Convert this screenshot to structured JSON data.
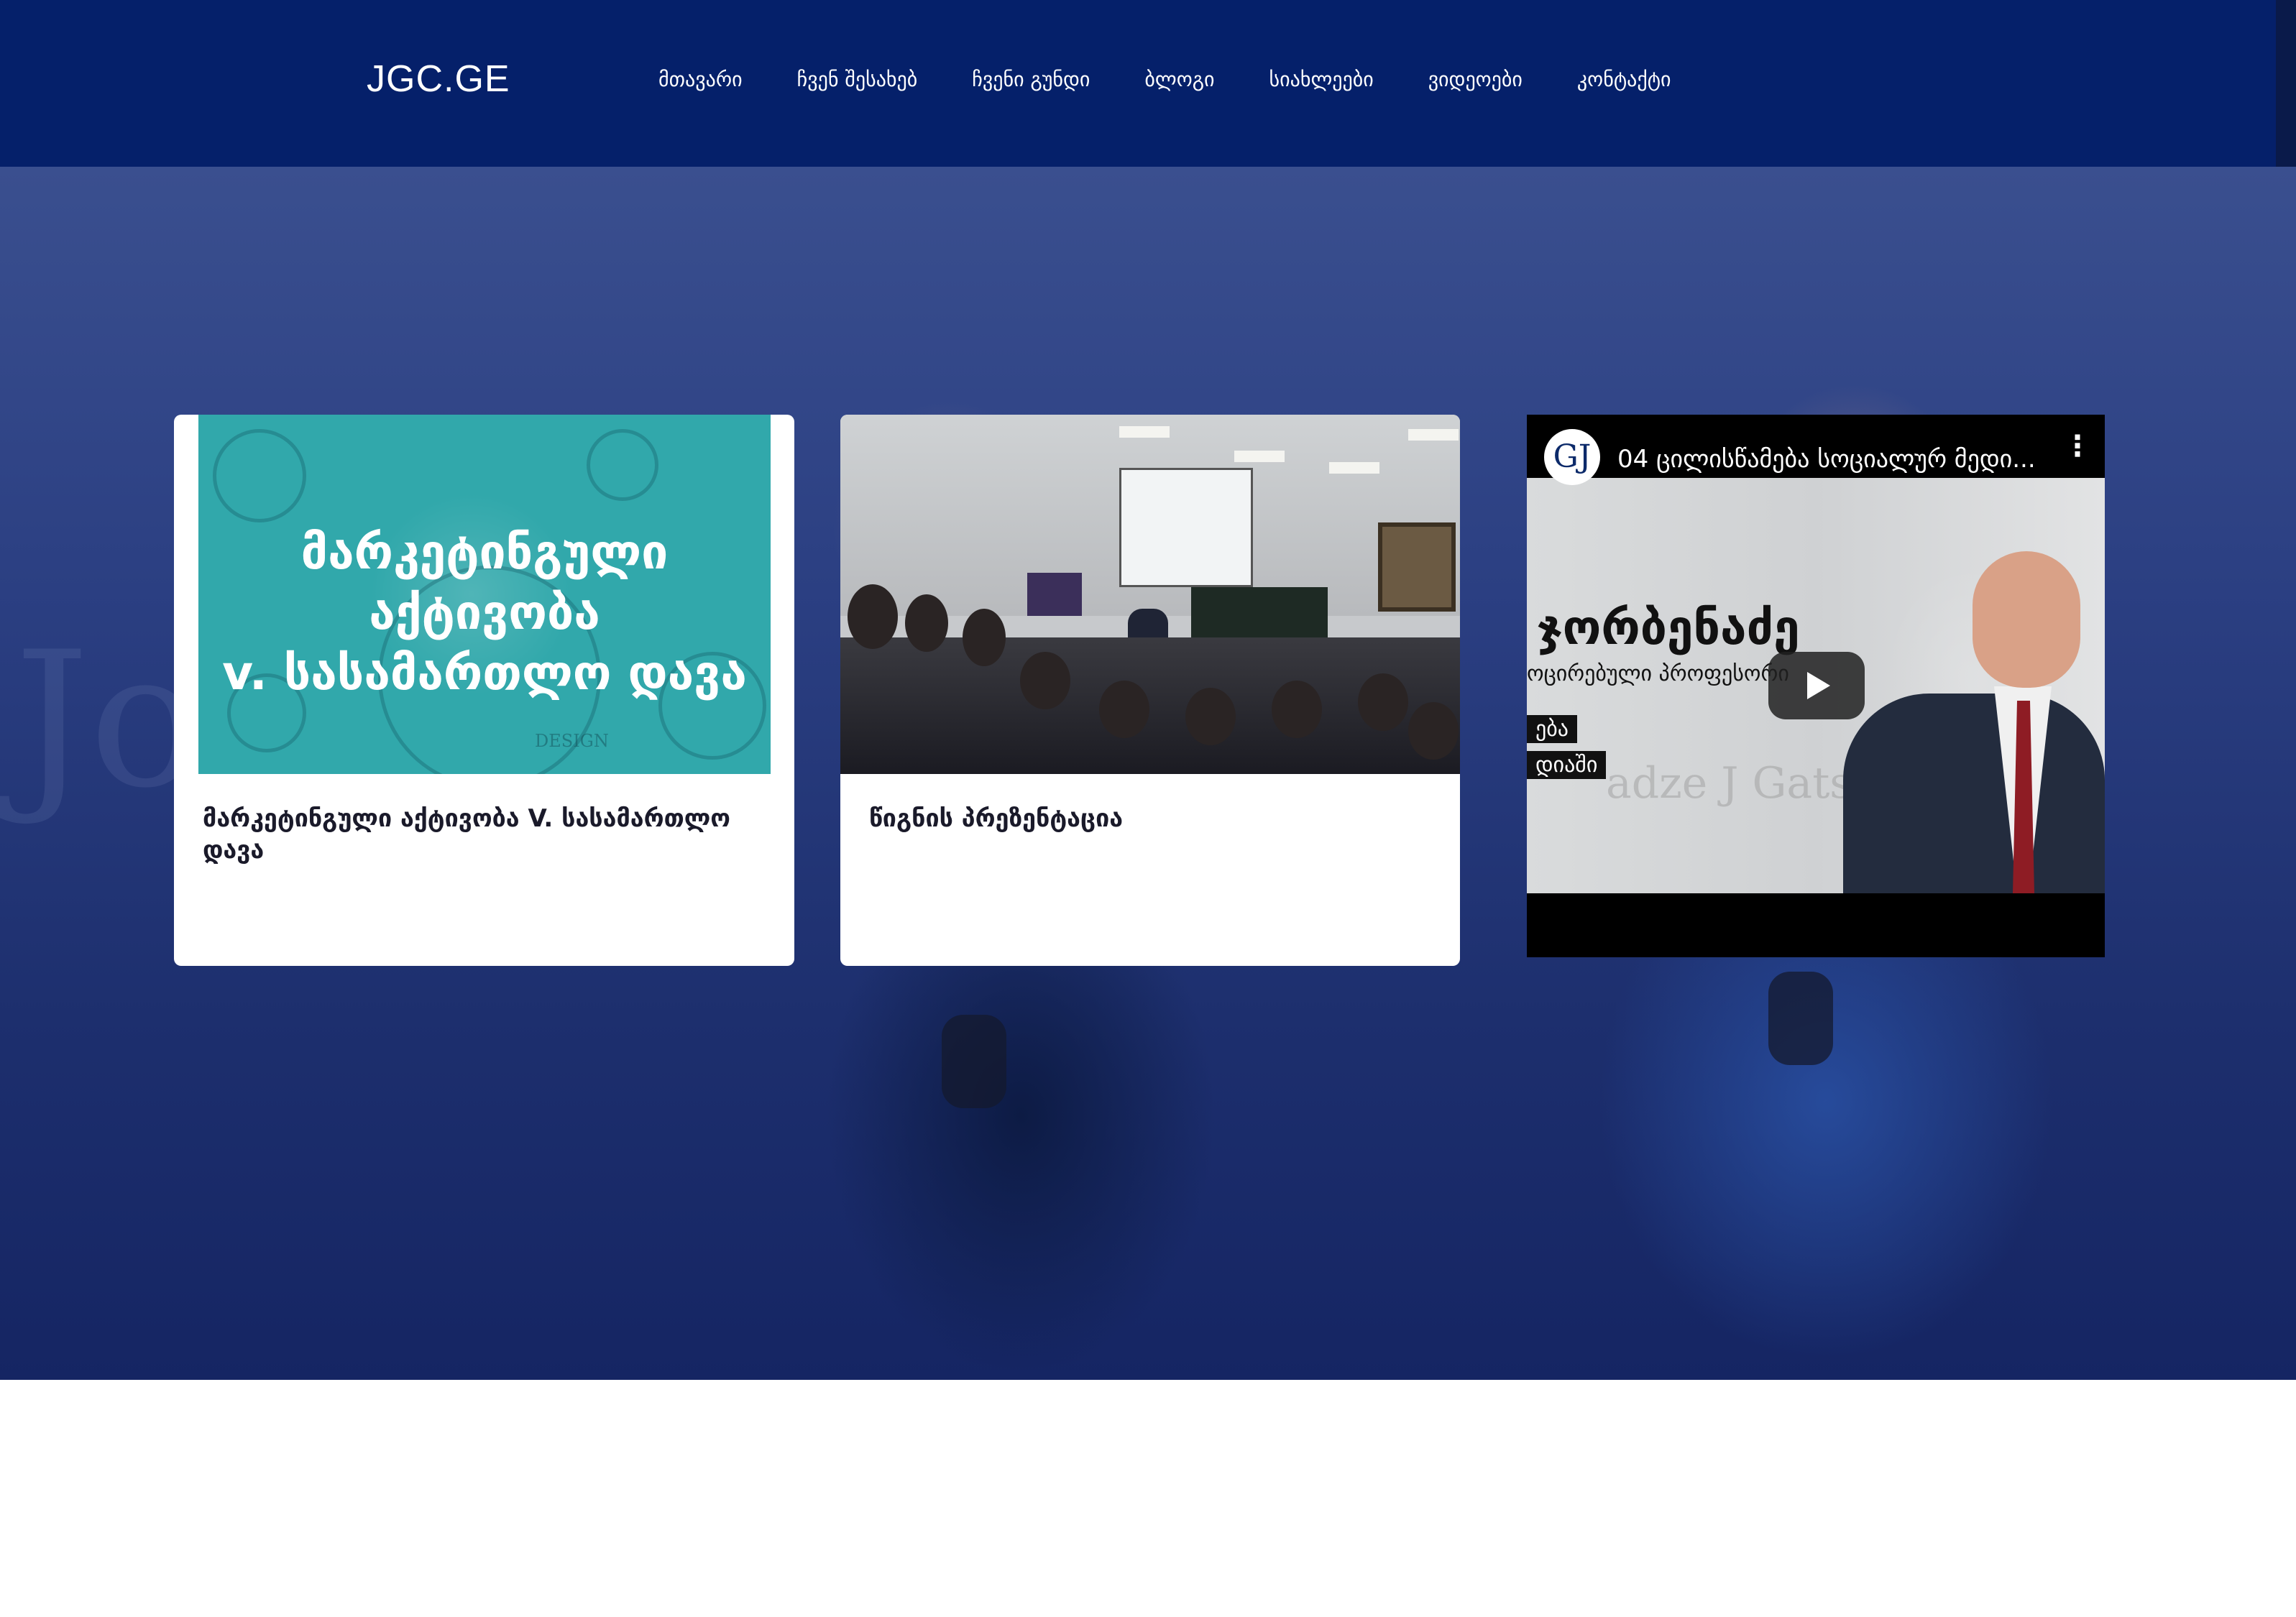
{
  "header": {
    "logo": "JGC.GE",
    "nav": [
      {
        "label": "მთავარი"
      },
      {
        "label": "ჩვენ შესახებ"
      },
      {
        "label": "ჩვენი გუნდი"
      },
      {
        "label": "ბლოგი"
      },
      {
        "label": "სიახლეები"
      },
      {
        "label": "ვიდეოები"
      },
      {
        "label": "კონტაქტი"
      }
    ]
  },
  "hero": {
    "background_image": "team-photo-blue-overlay",
    "overlay_color": "#1a2f6e"
  },
  "cards": [
    {
      "title": "მარკეტინგული აქტივობა V. სასამართლო დავა",
      "thumbnail_text_line1": "მარკეტინგული აქტივობა",
      "thumbnail_text_line2": "v. სასამართლო დავა",
      "thumbnail_caption": "DESIGN"
    },
    {
      "title": "წიგნის პრეზენტაცია"
    }
  ],
  "video": {
    "title": "04 ცილისწამება სოციალურ მედი...",
    "channel_initial": "GJ",
    "overlay_name": "ჯორბენაძე",
    "overlay_subtitle": "ოცირებული პროფესორი",
    "overlay_tag1": "ება",
    "overlay_tag2": "დიაში",
    "overlay_watermark": "adze J Gatserelia",
    "menu_glyph": "⋮"
  },
  "colors": {
    "header_bg": "#05206a",
    "card_bg": "#ffffff",
    "thumb1_bg": "#31a8ab",
    "title_text": "#1a1a2a"
  }
}
